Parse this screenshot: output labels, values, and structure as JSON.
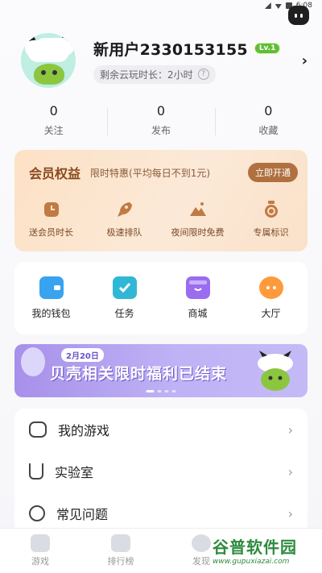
{
  "status_bar": {
    "time": "6:08"
  },
  "profile": {
    "username": "新用户2330153155",
    "level": "Lv.1",
    "cloud_time_label": "剩余云玩时长：2小时"
  },
  "stats": [
    {
      "value": "0",
      "label": "关注"
    },
    {
      "value": "0",
      "label": "发布"
    },
    {
      "value": "0",
      "label": "收藏"
    }
  ],
  "vip": {
    "title": "会员权益",
    "promo": "限时特惠(平均每日不到1元)",
    "cta": "立即开通",
    "items": [
      {
        "label": "送会员时长",
        "icon": "clock-icon"
      },
      {
        "label": "极速排队",
        "icon": "rocket-icon"
      },
      {
        "label": "夜间限时免费",
        "icon": "mountain-icon"
      },
      {
        "label": "专属标识",
        "icon": "badge-icon"
      }
    ],
    "colors": {
      "title": "#8a4a1e",
      "button": "#b0703f"
    }
  },
  "quick_actions": [
    {
      "label": "我的钱包",
      "icon": "wallet-icon",
      "color": "#3aa3f0"
    },
    {
      "label": "任务",
      "icon": "task-icon",
      "color": "#31b7d6"
    },
    {
      "label": "商城",
      "icon": "shop-icon",
      "color": "#9b6cf0"
    },
    {
      "label": "大厅",
      "icon": "chat-icon",
      "color": "#ff9a3c"
    }
  ],
  "banner": {
    "date_tag": "2月20日",
    "text": "贝壳相关限时福利已结束"
  },
  "menu": [
    {
      "label": "我的游戏",
      "icon": "gamepad-icon"
    },
    {
      "label": "实验室",
      "icon": "flask-icon"
    },
    {
      "label": "常见问题",
      "icon": "help-circle-icon"
    }
  ],
  "tabbar": [
    {
      "label": "游戏",
      "icon": "gamepad-icon"
    },
    {
      "label": "排行榜",
      "icon": "trophy-icon"
    },
    {
      "label": "发现",
      "icon": "eye-icon"
    }
  ],
  "watermark": {
    "title": "谷普软件园",
    "url": "www.gupuxiazai.com"
  }
}
